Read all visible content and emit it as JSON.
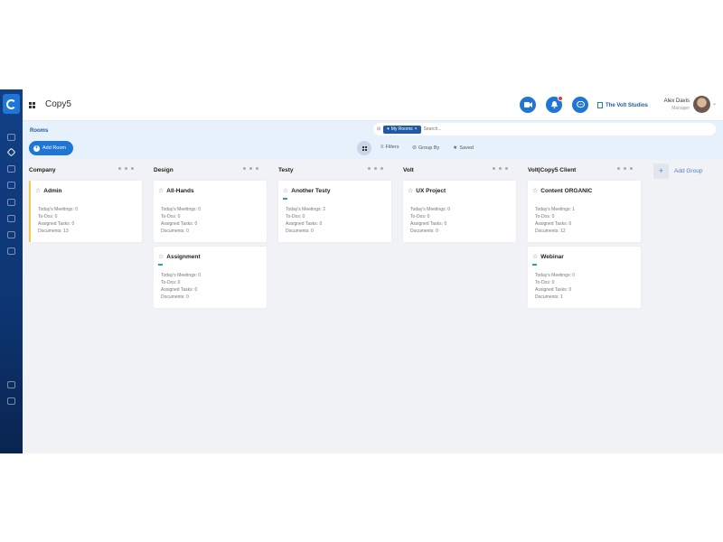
{
  "app": {
    "title": "Copy5"
  },
  "header": {
    "workspace": "The Volt Studios",
    "user_name": "Alex Davis",
    "user_role": "Manager"
  },
  "rooms_bar": {
    "label": "Rooms",
    "add_room_label": "Add Room",
    "search_chip": "My Rooms",
    "search_placeholder": "Search...",
    "filters_label": "Filters",
    "groupby_label": "Group By",
    "saved_label": "Saved"
  },
  "stat_labels": {
    "meetings": "Today's Meetings:",
    "todos": "To-Dos:",
    "tasks": "Assigned Tasks:",
    "documents": "Documents:"
  },
  "columns": [
    {
      "name": "Company",
      "cards": [
        {
          "title": "Admin",
          "meetings": 0,
          "todos": 0,
          "tasks": 0,
          "documents": 13
        }
      ]
    },
    {
      "name": "Design",
      "cards": [
        {
          "title": "All-Hands",
          "meetings": 0,
          "todos": 0,
          "tasks": 0,
          "documents": 0
        },
        {
          "title": "Assignment",
          "meetings": 0,
          "todos": 0,
          "tasks": 0,
          "documents": 0
        }
      ]
    },
    {
      "name": "Testy",
      "cards": [
        {
          "title": "Another Testy",
          "meetings": 2,
          "todos": 0,
          "tasks": 0,
          "documents": 0
        }
      ]
    },
    {
      "name": "Volt",
      "cards": [
        {
          "title": "UX Project",
          "meetings": 0,
          "todos": 0,
          "tasks": 0,
          "documents": 0
        }
      ]
    },
    {
      "name": "Volt|Copy5 Client",
      "cards": [
        {
          "title": "Content ORGANIC",
          "meetings": 1,
          "todos": 0,
          "tasks": 0,
          "documents": 12
        },
        {
          "title": "Webinar",
          "meetings": 0,
          "todos": 0,
          "tasks": 0,
          "documents": 1
        }
      ]
    }
  ],
  "add_group_label": "Add Group",
  "colors": {
    "primary": "#1f76d4",
    "sidebar": "#0d3572",
    "accent_yellow": "#f2c94c",
    "tag_teal": "#2aa3a3"
  }
}
